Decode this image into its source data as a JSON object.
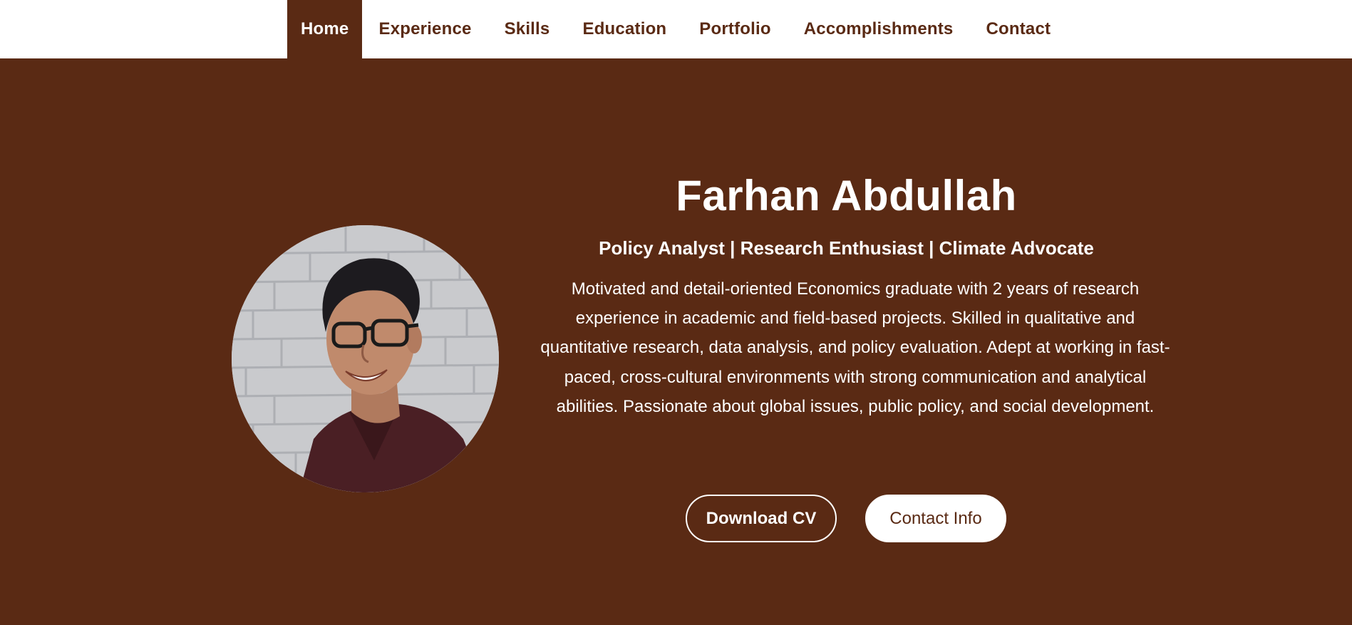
{
  "nav": {
    "items": [
      {
        "label": "Home",
        "active": true
      },
      {
        "label": "Experience",
        "active": false
      },
      {
        "label": "Skills",
        "active": false
      },
      {
        "label": "Education",
        "active": false
      },
      {
        "label": "Portfolio",
        "active": false
      },
      {
        "label": "Accomplishments",
        "active": false
      },
      {
        "label": "Contact",
        "active": false
      }
    ]
  },
  "profile": {
    "name": "Farhan Abdullah",
    "tagline": "Policy Analyst | Research Enthusiast | Climate Advocate",
    "bio": "Motivated and detail-oriented Economics graduate with 2 years of research experience in academic and field-based projects. Skilled in qualitative and quantitative research, data analysis, and policy evaluation. Adept at working in fast-paced, cross-cultural environments with strong communication and analytical abilities. Passionate about global issues, public policy, and social development."
  },
  "buttons": {
    "download_cv": "Download CV",
    "contact_info": "Contact Info"
  },
  "colors": {
    "brand_brown": "#5a2a14",
    "white": "#ffffff"
  },
  "icons": {
    "avatar": "profile-photo"
  }
}
